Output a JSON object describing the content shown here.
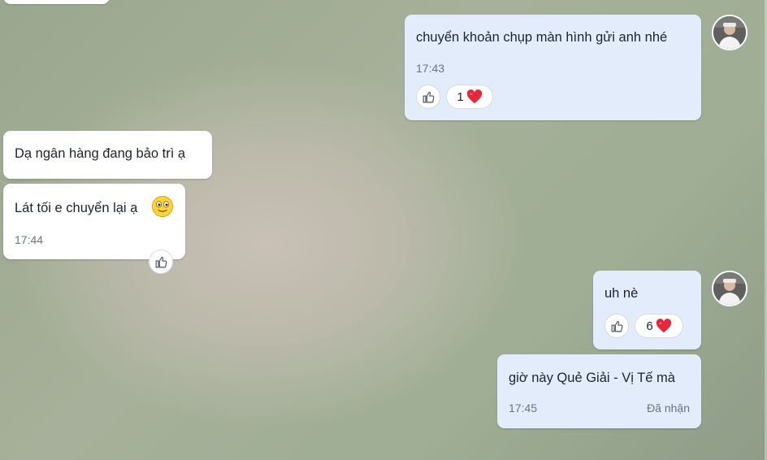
{
  "messages": [
    {
      "text": "chuyển khoản chụp màn hình gửi anh nhé",
      "time": "17:43",
      "reaction_count": "1"
    },
    {
      "text": "Dạ ngân hàng đang bảo trì ạ"
    },
    {
      "text": "Lát tối e chuyển lại ạ",
      "time": "17:44"
    },
    {
      "text": "uh nè",
      "reaction_count": "6"
    },
    {
      "text": "giờ này Quẻ  Giải - Vị Tế mà",
      "time": "17:45",
      "status": "Đã nhận"
    }
  ],
  "icons": {
    "like": "thumbs-up-icon",
    "reaction": "heart-icon",
    "emoji": "smiling-face-icon"
  },
  "colors": {
    "my_bubble": "#e2ecfb",
    "their_bubble": "#ffffff",
    "heart": "#e8263a"
  }
}
